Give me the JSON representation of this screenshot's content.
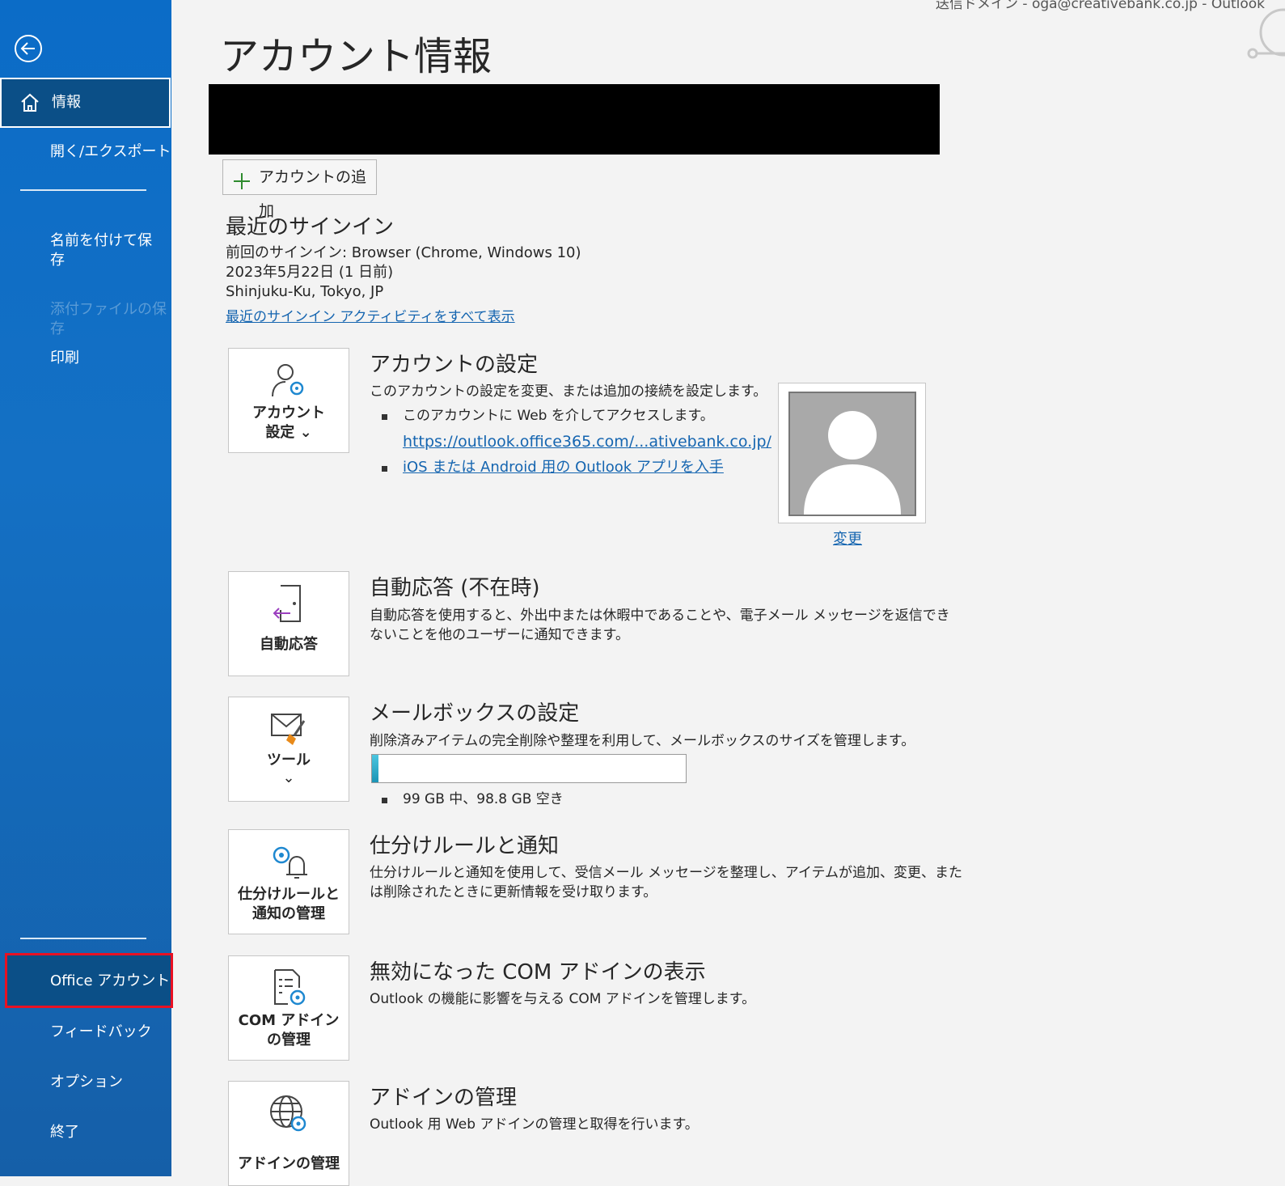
{
  "window": {
    "header_cut": "送信ドメイン - oga@creativebank.co.jp - Outlook"
  },
  "sidebar": {
    "items": [
      {
        "label": "情報"
      },
      {
        "label": "開く/エクスポート"
      },
      {
        "label": "名前を付けて保\n存"
      },
      {
        "label": "添付ファイルの保\n存"
      },
      {
        "label": "印刷"
      },
      {
        "label": "Office アカウント"
      },
      {
        "label": "フィードバック"
      },
      {
        "label": "オプション"
      },
      {
        "label": "終了"
      }
    ]
  },
  "main": {
    "title": "アカウント情報",
    "add_account": "アカウントの追加",
    "recent_signin": {
      "heading": "最近のサインイン",
      "line1": "前回のサインイン: Browser (Chrome, Windows 10)",
      "line2": "2023年5月22日 (1 日前)",
      "line3": "Shinjuku-Ku, Tokyo, JP",
      "link": "最近のサインイン アクティビティをすべて表示"
    },
    "account_settings": {
      "tile_label1": "アカウント",
      "tile_label2": "設定 ⌄",
      "heading": "アカウントの設定",
      "desc": "このアカウントの設定を変更、または追加の接続を設定します。",
      "bullet1": "このアカウントに Web を介してアクセスします。",
      "bullet1_link": "https://outlook.office365.com/...ativebank.co.jp/",
      "bullet2_link": "iOS または Android 用の Outlook アプリを入手",
      "change_link": "変更"
    },
    "auto_reply": {
      "tile_label": "自動応答",
      "heading": "自動応答 (不在時)",
      "desc1": "自動応答を使用すると、外出中または休暇中であることや、電子メール メッセージを返信でき",
      "desc2": "ないことを他のユーザーに通知できます。"
    },
    "mailbox": {
      "tile_label": "ツール",
      "tile_chevron": "⌄",
      "heading": "メールボックスの設定",
      "desc": "削除済みアイテムの完全削除や整理を利用して、メールボックスのサイズを管理します。",
      "usage_fraction": 0.02,
      "usage_text": "99 GB 中、98.8 GB 空き"
    },
    "rules": {
      "tile_label1": "仕分けルールと",
      "tile_label2": "通知の管理",
      "heading": "仕分けルールと通知",
      "desc1": "仕分けルールと通知を使用して、受信メール メッセージを整理し、アイテムが追加、変更、また",
      "desc2": "は削除されたときに更新情報を受け取ります。"
    },
    "com_addins": {
      "tile_label1": "COM アドイン",
      "tile_label2": "の管理",
      "heading": "無効になった COM アドインの表示",
      "desc": "Outlook の機能に影響を与える COM アドインを管理します。"
    },
    "addins": {
      "tile_label": "アドインの管理",
      "heading": "アドインの管理",
      "desc": "Outlook 用 Web アドインの管理と取得を行います。"
    }
  },
  "colors": {
    "sidebar": "#1470c4",
    "active": "#0b4f87",
    "highlight": "#e81123",
    "link": "#1565b0"
  }
}
